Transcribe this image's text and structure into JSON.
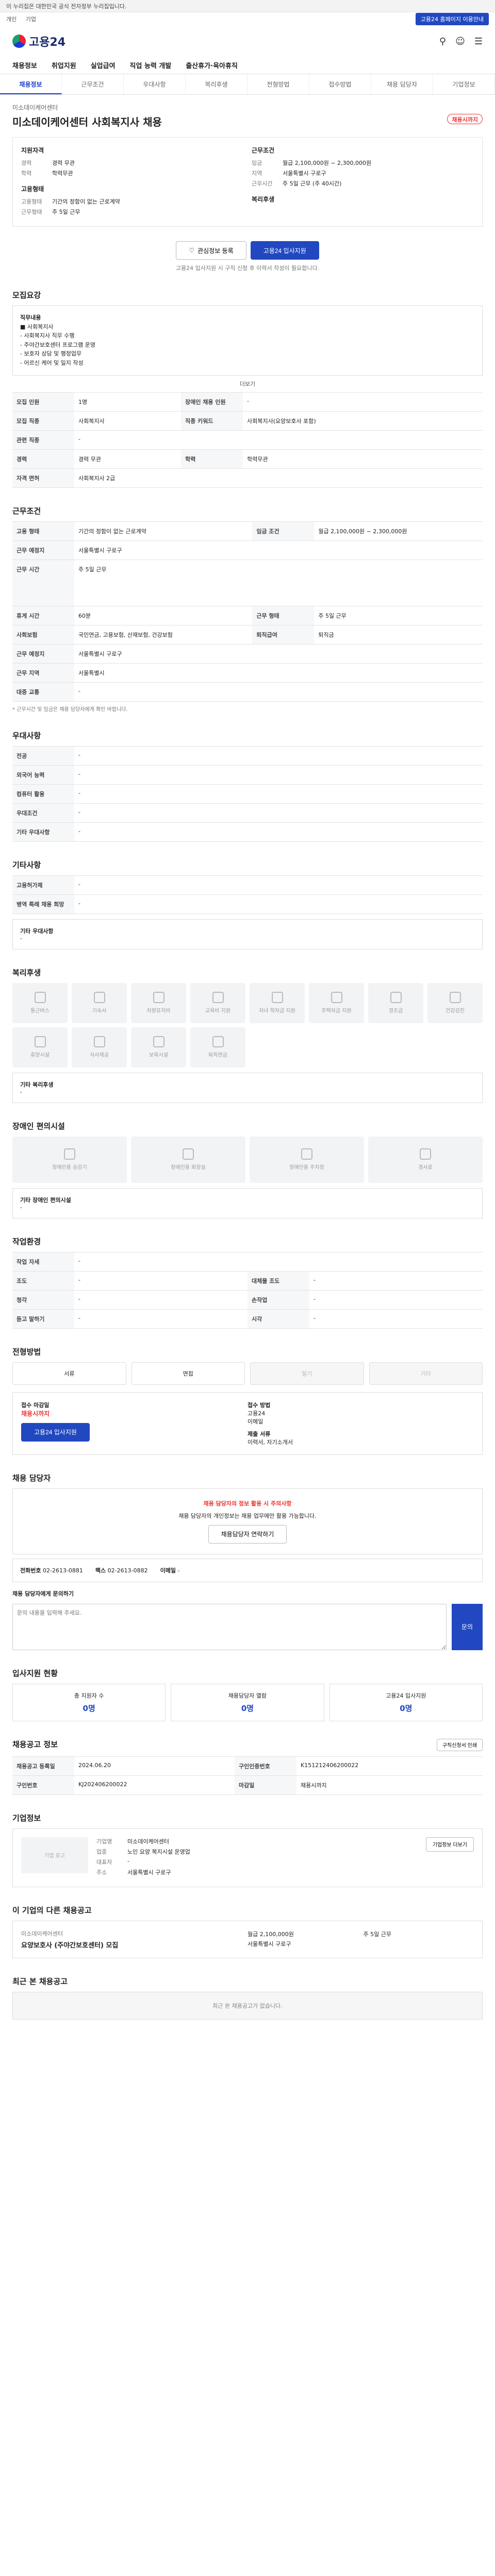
{
  "top": {
    "notice": "이 누리집은 대한민국 공식 전자정부 누리집입니다."
  },
  "util": {
    "left": [
      "개인",
      "기업"
    ],
    "right": "고용24 홈페이지 이용안내"
  },
  "header": {
    "logo": "고용24"
  },
  "gnb": [
    "채용정보",
    "취업지원",
    "실업급여",
    "직업 능력 개발",
    "출산휴가·육아휴직"
  ],
  "subtabs": [
    "채용정보",
    "근무조건",
    "우대사항",
    "복리후생",
    "전형방법",
    "접수방법",
    "채용 담당자",
    "기업정보"
  ],
  "job": {
    "company": "미소데이케어센터",
    "title": "미소데이케어센터 사회복지사 채용",
    "deadline_badge": "채용시까지",
    "req_title": "지원자격",
    "req": [
      [
        "경력",
        "경력 무관"
      ],
      [
        "학력",
        "학력무관"
      ]
    ],
    "cond_title": "근무조건",
    "cond": [
      [
        "임금",
        "월급 2,100,000원 ~ 2,300,000원"
      ],
      [
        "지역",
        "서울특별시 구로구"
      ],
      [
        "근무시간",
        "주 5일 근무 (주 40시간)"
      ]
    ],
    "contact_title": "고용형태",
    "contact": [
      [
        "고용형태",
        "기간의 정함이 없는 근로계약"
      ],
      [
        "근무형태",
        "주 5일 근무"
      ]
    ],
    "apply_title": "복리후생"
  },
  "actions": {
    "scrap": "관심정보 등록",
    "apply": "고용24 입사지원"
  },
  "actions_note": "고용24 입사지원 시 구직 신청 후 이력서 작성이 필요합니다.",
  "recruit": {
    "heading": "모집요강",
    "box_title": "직무내용",
    "box_lines": [
      "■ 사회복지사",
      "- 사회복지사 직무 수행",
      "- 주야간보호센터 프로그램 운영",
      "- 보호자 상담 및 행정업무",
      "- 어르신 케어 및 일지 작성"
    ],
    "more": "더보기",
    "rows": [
      [
        "모집 인원",
        "1명",
        "장애인 채용 인원",
        "-"
      ],
      [
        "모집 직종",
        "사회복지사",
        "직종 키워드",
        "사회복지사(요양보호사 포함)"
      ],
      [
        "관련 직종",
        "-",
        "",
        ""
      ],
      [
        "경력",
        "경력 무관",
        "학력",
        "학력무관"
      ],
      [
        "자격 면허",
        "사회복지사 2급",
        "",
        ""
      ]
    ]
  },
  "work": {
    "heading": "근무조건",
    "rows": [
      [
        "고용 형태",
        "기간의 정함이 없는 근로계약",
        "임금 조건",
        "월급 2,100,000원 ~ 2,300,000원"
      ],
      [
        "근무 예정지",
        "서울특별시 구로구",
        "",
        ""
      ],
      [
        "근무 시간",
        "주 5일 근무",
        "",
        ""
      ],
      [
        "휴게 시간",
        "60분",
        "근무 형태",
        "주 5일 근무"
      ],
      [
        "사회보험",
        "국민연금, 고용보험, 산재보험, 건강보험",
        "퇴직급여",
        "퇴직금"
      ],
      [
        "근무 예정지",
        "서울특별시 구로구",
        "",
        ""
      ],
      [
        "근무 지역",
        "서울특별시",
        "",
        ""
      ],
      [
        "대중 교통",
        "-",
        "",
        ""
      ]
    ],
    "note": "* 근무시간 및 임금은 채용 담당자에게 확인 바랍니다."
  },
  "pref": {
    "heading": "우대사항",
    "rows": [
      [
        "전공",
        "-"
      ],
      [
        "외국어 능력",
        "-"
      ],
      [
        "컴퓨터 활용",
        "-"
      ],
      [
        "우대조건",
        "-"
      ],
      [
        "기타 우대사항",
        "-"
      ]
    ]
  },
  "etc": {
    "heading": "기타사항",
    "rows": [
      [
        "고용허가제",
        "-"
      ],
      [
        "병역 특례 채용 희망",
        "-"
      ]
    ],
    "box_title": "기타 우대사항",
    "box_value": "-"
  },
  "welfare": {
    "heading": "복리후생",
    "tiles": [
      "통근버스",
      "기숙사",
      "차량유지비",
      "교육비 지원",
      "자녀 학자금 지원",
      "주택자금 지원",
      "경조금",
      "건강검진",
      "휴양시설",
      "식사제공",
      "보육시설",
      "퇴직연금"
    ],
    "box_title": "기타 복리후생",
    "box_value": "-"
  },
  "disability": {
    "heading": "장애인 편의시설",
    "tiles": [
      "장애인용 승강기",
      "장애인용 화장실",
      "장애인용 주차장",
      "경사로"
    ],
    "box_title": "기타 장애인 편의시설",
    "box_value": "-"
  },
  "env": {
    "heading": "작업환경",
    "rows": [
      [
        "작업 자세",
        "-",
        "",
        ""
      ],
      [
        "조도",
        "-",
        "대체물 조도",
        "-"
      ],
      [
        "청각",
        "-",
        "손작업",
        "-"
      ],
      [
        "듣고 말하기",
        "-",
        "시각",
        "-"
      ]
    ]
  },
  "process": {
    "heading": "전형방법",
    "steps": [
      "서류",
      "면접",
      "필기",
      "기타"
    ],
    "step_state": [
      1,
      1,
      0,
      0
    ]
  },
  "apply": {
    "deadline_label": "접수 마감일",
    "deadline": "채용시까지",
    "method_label": "접수 방법",
    "methods": [
      "고용24",
      "이메일"
    ],
    "docs_label": "제출 서류",
    "docs": "이력서, 자기소개서",
    "btn": "고용24 입사지원"
  },
  "manager": {
    "heading": "채용 담당자",
    "alert_title": "채용 담당자의 정보 활용 시 주의사항",
    "alert_body": "채용 담당자의 개인정보는 채용 업무에만 활용 가능합니다.",
    "alert_btn": "채용담당자 연락하기",
    "contact": [
      [
        "전화번호",
        "02-2613-0881"
      ],
      [
        "팩스",
        "02-2613-0882"
      ],
      [
        "이메일",
        "-"
      ]
    ],
    "inq_label": "채용 담당자에게 문의하기",
    "inq_placeholder": "문의 내용을 입력해 주세요.",
    "inq_btn": "문의"
  },
  "applicants": {
    "heading": "입사지원 현황",
    "items": [
      [
        "총 지원자 수",
        "0명"
      ],
      [
        "채용담당자 열람",
        "0명"
      ],
      [
        "고용24 입사지원",
        "0명"
      ]
    ]
  },
  "info": {
    "heading": "채용공고 정보",
    "print": "구직신청서 인쇄",
    "rows": [
      [
        "채용공고 등록일",
        "2024.06.20",
        "구인인증번호",
        "K151212406200022"
      ],
      [
        "구인번호",
        "KJ202406200022",
        "마감일",
        "채용시까지"
      ]
    ]
  },
  "company": {
    "heading": "기업정보",
    "logo_placeholder": "기업 로고",
    "rows": [
      [
        "기업명",
        "미소데이케어센터"
      ],
      [
        "업종",
        "노인 요양 복지시설 운영업"
      ],
      [
        "대표자",
        "-"
      ],
      [
        "주소",
        "서울특별시 구로구"
      ]
    ],
    "btn": "기업정보 더보기"
  },
  "related": {
    "heading": "이 기업의 다른 채용공고",
    "company": "미소데이케어센터",
    "title": "요양보호사 (주야간보호센터) 모집",
    "lines": [
      "월급 2,100,000원",
      "서울특별시 구로구",
      "주 5일 근무"
    ]
  },
  "recent": {
    "heading": "최근 본 채용공고",
    "empty": "최근 본 채용공고가 없습니다."
  }
}
